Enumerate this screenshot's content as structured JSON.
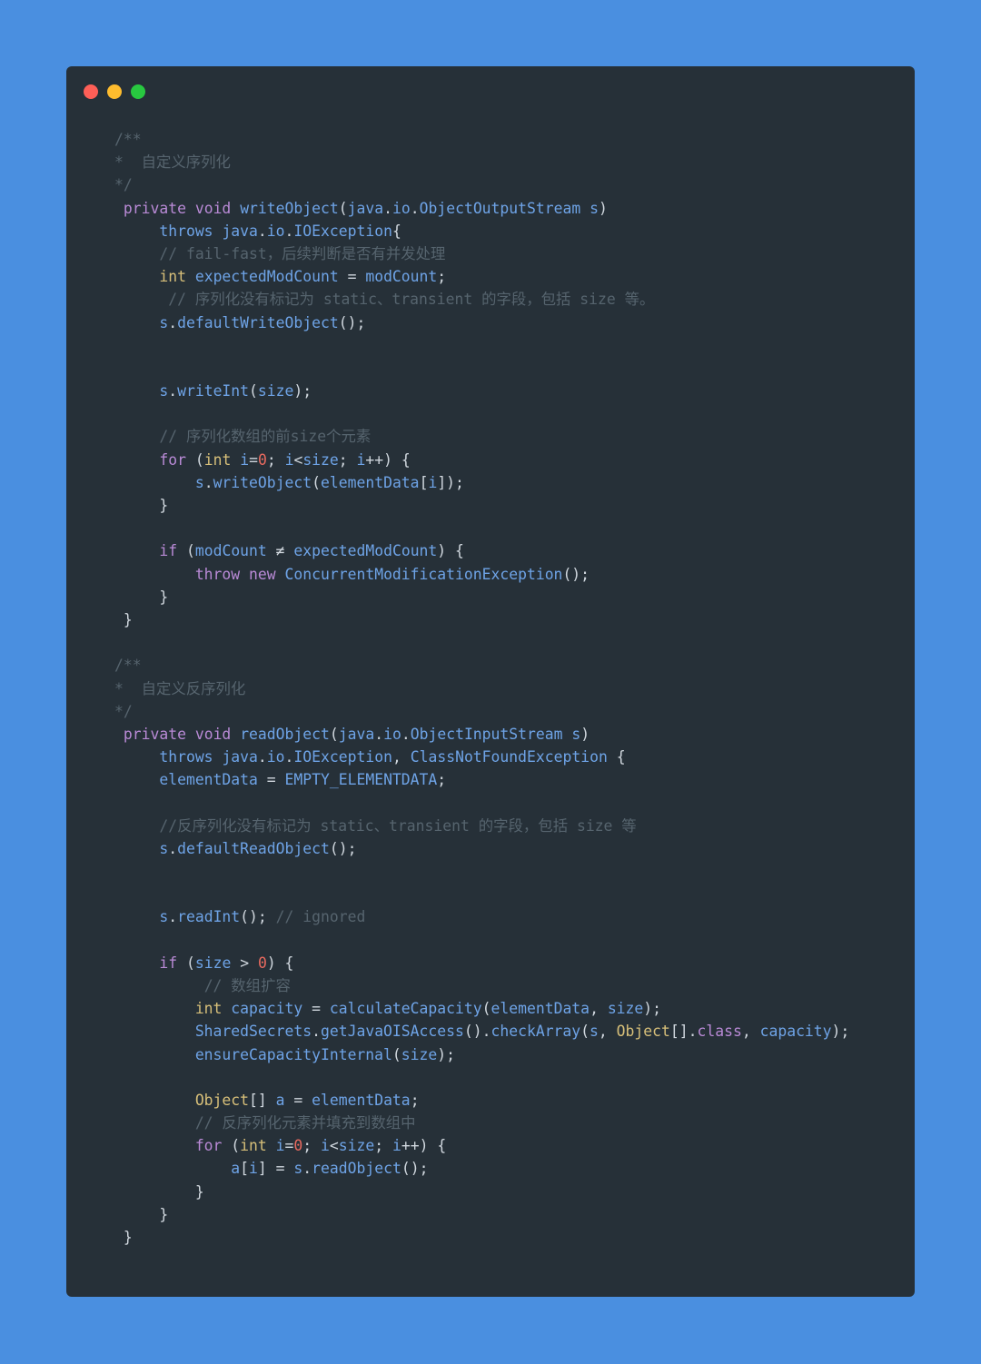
{
  "window": {
    "controls": [
      {
        "name": "close",
        "color": "#fe5f57"
      },
      {
        "name": "minimize",
        "color": "#febc2e"
      },
      {
        "name": "maximize",
        "color": "#28c840"
      }
    ]
  },
  "theme": {
    "background": "#4a8fe0",
    "panel": "#263038",
    "keyword": "#b98ad6",
    "type": "#d7bf79",
    "identifier": "#6ea3e6",
    "number": "#e96a5f",
    "comment": "#56646e",
    "punctuation": "#d0d7de"
  },
  "code": {
    "language": "java",
    "lines": [
      {
        "indent": "",
        "tokens": [
          [
            "comment",
            "/**"
          ]
        ]
      },
      {
        "indent": "",
        "tokens": [
          [
            "comment",
            "*  自定义序列化"
          ]
        ]
      },
      {
        "indent": "",
        "tokens": [
          [
            "comment",
            "*/"
          ]
        ]
      },
      {
        "indent": " ",
        "tokens": [
          [
            "keyword",
            "private"
          ],
          [
            "punct",
            " "
          ],
          [
            "keyword",
            "void"
          ],
          [
            "punct",
            " "
          ],
          [
            "ident",
            "writeObject"
          ],
          [
            "punct",
            "("
          ],
          [
            "ident",
            "java"
          ],
          [
            "punct",
            "."
          ],
          [
            "ident",
            "io"
          ],
          [
            "punct",
            "."
          ],
          [
            "ident",
            "ObjectOutputStream"
          ],
          [
            "punct",
            " "
          ],
          [
            "ident",
            "s"
          ],
          [
            "punct",
            ")"
          ]
        ]
      },
      {
        "indent": "     ",
        "tokens": [
          [
            "ident",
            "throws"
          ],
          [
            "punct",
            " "
          ],
          [
            "ident",
            "java"
          ],
          [
            "punct",
            "."
          ],
          [
            "ident",
            "io"
          ],
          [
            "punct",
            "."
          ],
          [
            "ident",
            "IOException"
          ],
          [
            "punct",
            "{"
          ]
        ]
      },
      {
        "indent": "     ",
        "tokens": [
          [
            "comment",
            "// fail-fast，后续判断是否有并发处理"
          ]
        ]
      },
      {
        "indent": "     ",
        "tokens": [
          [
            "type",
            "int"
          ],
          [
            "punct",
            " "
          ],
          [
            "ident",
            "expectedModCount"
          ],
          [
            "punct",
            " = "
          ],
          [
            "ident",
            "modCount"
          ],
          [
            "punct",
            ";"
          ]
        ]
      },
      {
        "indent": "      ",
        "tokens": [
          [
            "comment",
            "// 序列化没有标记为 static、transient 的字段，包括 size 等。"
          ]
        ]
      },
      {
        "indent": "     ",
        "tokens": [
          [
            "ident",
            "s"
          ],
          [
            "punct",
            "."
          ],
          [
            "ident",
            "defaultWriteObject"
          ],
          [
            "punct",
            "();"
          ]
        ]
      },
      {
        "indent": "",
        "tokens": []
      },
      {
        "indent": "",
        "tokens": []
      },
      {
        "indent": "     ",
        "tokens": [
          [
            "ident",
            "s"
          ],
          [
            "punct",
            "."
          ],
          [
            "ident",
            "writeInt"
          ],
          [
            "punct",
            "("
          ],
          [
            "ident",
            "size"
          ],
          [
            "punct",
            ");"
          ]
        ]
      },
      {
        "indent": "",
        "tokens": []
      },
      {
        "indent": "     ",
        "tokens": [
          [
            "comment",
            "// 序列化数组的前size个元素"
          ]
        ]
      },
      {
        "indent": "     ",
        "tokens": [
          [
            "keyword",
            "for"
          ],
          [
            "punct",
            " ("
          ],
          [
            "type",
            "int"
          ],
          [
            "punct",
            " "
          ],
          [
            "ident",
            "i"
          ],
          [
            "punct",
            "="
          ],
          [
            "number",
            "0"
          ],
          [
            "punct",
            "; "
          ],
          [
            "ident",
            "i"
          ],
          [
            "punct",
            "<"
          ],
          [
            "ident",
            "size"
          ],
          [
            "punct",
            "; "
          ],
          [
            "ident",
            "i"
          ],
          [
            "punct",
            "++) {"
          ]
        ]
      },
      {
        "indent": "         ",
        "tokens": [
          [
            "ident",
            "s"
          ],
          [
            "punct",
            "."
          ],
          [
            "ident",
            "writeObject"
          ],
          [
            "punct",
            "("
          ],
          [
            "ident",
            "elementData"
          ],
          [
            "punct",
            "["
          ],
          [
            "ident",
            "i"
          ],
          [
            "punct",
            "]);"
          ]
        ]
      },
      {
        "indent": "     ",
        "tokens": [
          [
            "punct",
            "}"
          ]
        ]
      },
      {
        "indent": "",
        "tokens": []
      },
      {
        "indent": "     ",
        "tokens": [
          [
            "keyword",
            "if"
          ],
          [
            "punct",
            " ("
          ],
          [
            "ident",
            "modCount"
          ],
          [
            "punct",
            " ≠ "
          ],
          [
            "ident",
            "expectedModCount"
          ],
          [
            "punct",
            ") {"
          ]
        ]
      },
      {
        "indent": "         ",
        "tokens": [
          [
            "keyword",
            "throw"
          ],
          [
            "punct",
            " "
          ],
          [
            "keyword",
            "new"
          ],
          [
            "punct",
            " "
          ],
          [
            "ident",
            "ConcurrentModificationException"
          ],
          [
            "punct",
            "();"
          ]
        ]
      },
      {
        "indent": "     ",
        "tokens": [
          [
            "punct",
            "}"
          ]
        ]
      },
      {
        "indent": " ",
        "tokens": [
          [
            "punct",
            "}"
          ]
        ]
      },
      {
        "indent": "",
        "tokens": []
      },
      {
        "indent": "",
        "tokens": [
          [
            "comment",
            "/**"
          ]
        ]
      },
      {
        "indent": "",
        "tokens": [
          [
            "comment",
            "*  自定义反序列化"
          ]
        ]
      },
      {
        "indent": "",
        "tokens": [
          [
            "comment",
            "*/"
          ]
        ]
      },
      {
        "indent": " ",
        "tokens": [
          [
            "keyword",
            "private"
          ],
          [
            "punct",
            " "
          ],
          [
            "keyword",
            "void"
          ],
          [
            "punct",
            " "
          ],
          [
            "ident",
            "readObject"
          ],
          [
            "punct",
            "("
          ],
          [
            "ident",
            "java"
          ],
          [
            "punct",
            "."
          ],
          [
            "ident",
            "io"
          ],
          [
            "punct",
            "."
          ],
          [
            "ident",
            "ObjectInputStream"
          ],
          [
            "punct",
            " "
          ],
          [
            "ident",
            "s"
          ],
          [
            "punct",
            ")"
          ]
        ]
      },
      {
        "indent": "     ",
        "tokens": [
          [
            "ident",
            "throws"
          ],
          [
            "punct",
            " "
          ],
          [
            "ident",
            "java"
          ],
          [
            "punct",
            "."
          ],
          [
            "ident",
            "io"
          ],
          [
            "punct",
            "."
          ],
          [
            "ident",
            "IOException"
          ],
          [
            "punct",
            ", "
          ],
          [
            "ident",
            "ClassNotFoundException"
          ],
          [
            "punct",
            " {"
          ]
        ]
      },
      {
        "indent": "     ",
        "tokens": [
          [
            "ident",
            "elementData"
          ],
          [
            "punct",
            " = "
          ],
          [
            "ident",
            "EMPTY_ELEMENTDATA"
          ],
          [
            "punct",
            ";"
          ]
        ]
      },
      {
        "indent": "",
        "tokens": []
      },
      {
        "indent": "     ",
        "tokens": [
          [
            "comment",
            "//反序列化没有标记为 static、transient 的字段，包括 size 等"
          ]
        ]
      },
      {
        "indent": "     ",
        "tokens": [
          [
            "ident",
            "s"
          ],
          [
            "punct",
            "."
          ],
          [
            "ident",
            "defaultReadObject"
          ],
          [
            "punct",
            "();"
          ]
        ]
      },
      {
        "indent": "",
        "tokens": []
      },
      {
        "indent": "",
        "tokens": []
      },
      {
        "indent": "     ",
        "tokens": [
          [
            "ident",
            "s"
          ],
          [
            "punct",
            "."
          ],
          [
            "ident",
            "readInt"
          ],
          [
            "punct",
            "(); "
          ],
          [
            "comment",
            "// ignored"
          ]
        ]
      },
      {
        "indent": "",
        "tokens": []
      },
      {
        "indent": "     ",
        "tokens": [
          [
            "keyword",
            "if"
          ],
          [
            "punct",
            " ("
          ],
          [
            "ident",
            "size"
          ],
          [
            "punct",
            " > "
          ],
          [
            "number",
            "0"
          ],
          [
            "punct",
            ") {"
          ]
        ]
      },
      {
        "indent": "          ",
        "tokens": [
          [
            "comment",
            "// 数组扩容"
          ]
        ]
      },
      {
        "indent": "         ",
        "tokens": [
          [
            "type",
            "int"
          ],
          [
            "punct",
            " "
          ],
          [
            "ident",
            "capacity"
          ],
          [
            "punct",
            " = "
          ],
          [
            "ident",
            "calculateCapacity"
          ],
          [
            "punct",
            "("
          ],
          [
            "ident",
            "elementData"
          ],
          [
            "punct",
            ", "
          ],
          [
            "ident",
            "size"
          ],
          [
            "punct",
            ");"
          ]
        ]
      },
      {
        "indent": "         ",
        "tokens": [
          [
            "ident",
            "SharedSecrets"
          ],
          [
            "punct",
            "."
          ],
          [
            "ident",
            "getJavaOISAccess"
          ],
          [
            "punct",
            "()."
          ],
          [
            "ident",
            "checkArray"
          ],
          [
            "punct",
            "("
          ],
          [
            "ident",
            "s"
          ],
          [
            "punct",
            ", "
          ],
          [
            "type",
            "Object"
          ],
          [
            "punct",
            "[]."
          ],
          [
            "keyword",
            "class"
          ],
          [
            "punct",
            ", "
          ],
          [
            "ident",
            "capacity"
          ],
          [
            "punct",
            ");"
          ]
        ]
      },
      {
        "indent": "         ",
        "tokens": [
          [
            "ident",
            "ensureCapacityInternal"
          ],
          [
            "punct",
            "("
          ],
          [
            "ident",
            "size"
          ],
          [
            "punct",
            ");"
          ]
        ]
      },
      {
        "indent": "",
        "tokens": []
      },
      {
        "indent": "         ",
        "tokens": [
          [
            "type",
            "Object"
          ],
          [
            "punct",
            "[] "
          ],
          [
            "ident",
            "a"
          ],
          [
            "punct",
            " = "
          ],
          [
            "ident",
            "elementData"
          ],
          [
            "punct",
            ";"
          ]
        ]
      },
      {
        "indent": "         ",
        "tokens": [
          [
            "comment",
            "// 反序列化元素并填充到数组中"
          ]
        ]
      },
      {
        "indent": "         ",
        "tokens": [
          [
            "keyword",
            "for"
          ],
          [
            "punct",
            " ("
          ],
          [
            "type",
            "int"
          ],
          [
            "punct",
            " "
          ],
          [
            "ident",
            "i"
          ],
          [
            "punct",
            "="
          ],
          [
            "number",
            "0"
          ],
          [
            "punct",
            "; "
          ],
          [
            "ident",
            "i"
          ],
          [
            "punct",
            "<"
          ],
          [
            "ident",
            "size"
          ],
          [
            "punct",
            "; "
          ],
          [
            "ident",
            "i"
          ],
          [
            "punct",
            "++) {"
          ]
        ]
      },
      {
        "indent": "             ",
        "tokens": [
          [
            "ident",
            "a"
          ],
          [
            "punct",
            "["
          ],
          [
            "ident",
            "i"
          ],
          [
            "punct",
            "] = "
          ],
          [
            "ident",
            "s"
          ],
          [
            "punct",
            "."
          ],
          [
            "ident",
            "readObject"
          ],
          [
            "punct",
            "();"
          ]
        ]
      },
      {
        "indent": "         ",
        "tokens": [
          [
            "punct",
            "}"
          ]
        ]
      },
      {
        "indent": "     ",
        "tokens": [
          [
            "punct",
            "}"
          ]
        ]
      },
      {
        "indent": " ",
        "tokens": [
          [
            "punct",
            "}"
          ]
        ]
      }
    ]
  }
}
